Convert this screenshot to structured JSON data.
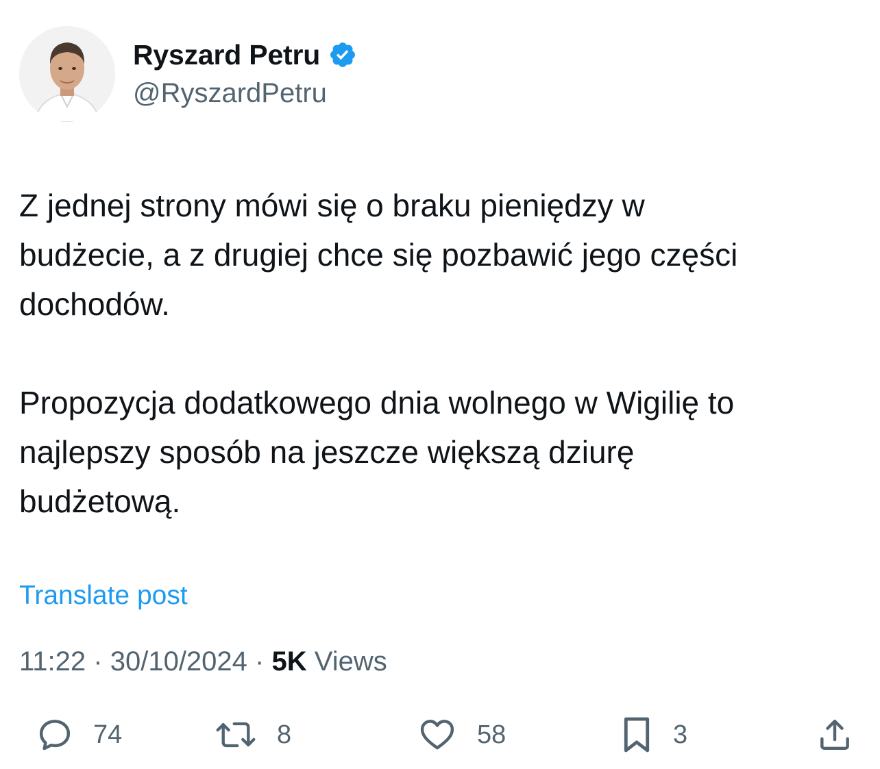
{
  "author": {
    "display_name": "Ryszard Petru",
    "handle": "@RyszardPetru",
    "verified": true,
    "verified_color": "#1d9bf0"
  },
  "post": {
    "paragraphs": [
      "Z jednej strony mówi się o braku pieniędzy w\nbudżecie, a z drugiej chce się pozbawić jego części\ndochodów.",
      "Propozycja dodatkowego dnia wolnego w Wigilię to\nnajlepszy sposób na jeszcze większą dziurę\nbudżetową."
    ],
    "translate_label": "Translate post"
  },
  "meta": {
    "time": "11:22",
    "separator": "·",
    "date": "30/10/2024",
    "views_count": "5K",
    "views_label": "Views"
  },
  "actions": {
    "reply": {
      "icon": "reply-icon",
      "count": "74"
    },
    "repost": {
      "icon": "repost-icon",
      "count": "8"
    },
    "like": {
      "icon": "heart-icon",
      "count": "58"
    },
    "bookmark": {
      "icon": "bookmark-icon",
      "count": "3"
    },
    "share": {
      "icon": "share-icon"
    }
  },
  "colors": {
    "text_primary": "#0f1419",
    "text_secondary": "#536471",
    "link": "#1d9bf0"
  }
}
